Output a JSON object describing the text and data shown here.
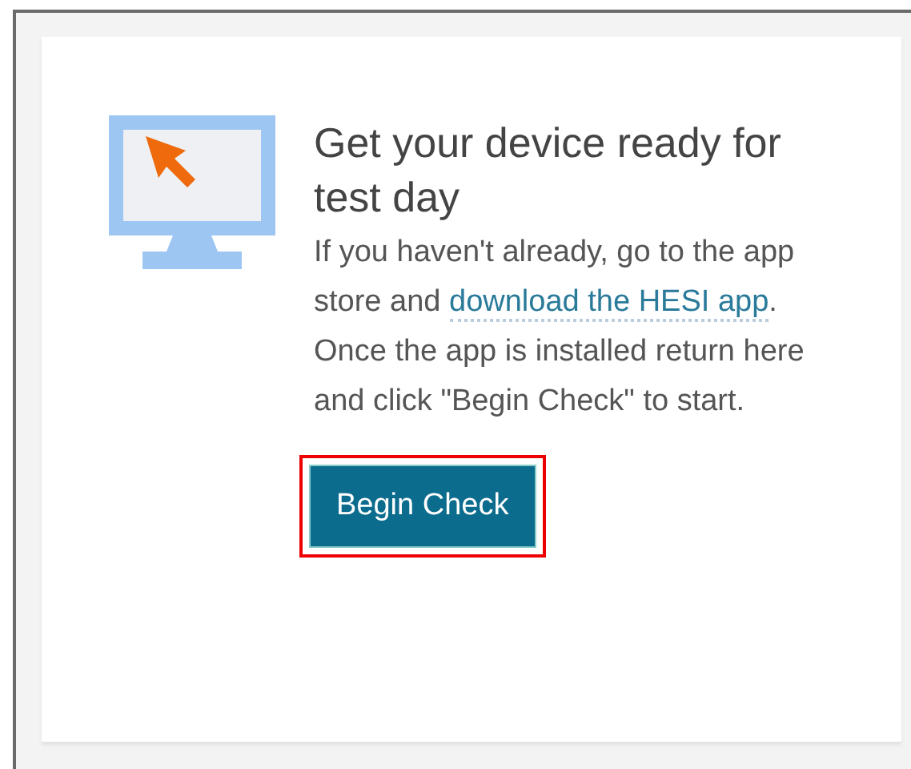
{
  "card": {
    "title": "Get your device ready for test day",
    "body_parts": [
      {
        "kind": "text",
        "text": "If you haven't already, go to the app store and "
      },
      {
        "kind": "link",
        "text": "download the HESI app"
      },
      {
        "kind": "text",
        "text": ". Once the app is installed return here and click \"Begin Check\" to start."
      }
    ],
    "button": {
      "label": "Begin Check",
      "highlighted": true
    }
  }
}
